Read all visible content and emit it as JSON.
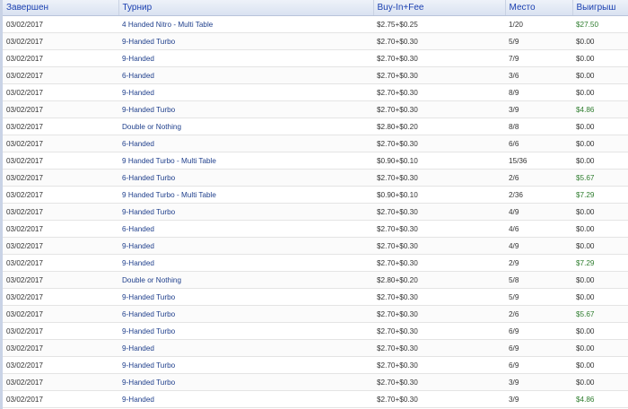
{
  "table": {
    "headers": {
      "completed": "Завершен",
      "tournament": "Турнир",
      "buyin": "Buy-In+Fee",
      "place": "Место",
      "winnings": "Выигрыш"
    },
    "rows": [
      {
        "date": "03/02/2017",
        "tournament": "4 Handed Nitro - Multi Table",
        "buyin": "$2.75+$0.25",
        "place": "1/20",
        "winnings": "$27.50",
        "won": true
      },
      {
        "date": "03/02/2017",
        "tournament": "9-Handed Turbo",
        "buyin": "$2.70+$0.30",
        "place": "5/9",
        "winnings": "$0.00",
        "won": false
      },
      {
        "date": "03/02/2017",
        "tournament": "9-Handed",
        "buyin": "$2.70+$0.30",
        "place": "7/9",
        "winnings": "$0.00",
        "won": false
      },
      {
        "date": "03/02/2017",
        "tournament": "6-Handed",
        "buyin": "$2.70+$0.30",
        "place": "3/6",
        "winnings": "$0.00",
        "won": false
      },
      {
        "date": "03/02/2017",
        "tournament": "9-Handed",
        "buyin": "$2.70+$0.30",
        "place": "8/9",
        "winnings": "$0.00",
        "won": false
      },
      {
        "date": "03/02/2017",
        "tournament": "9-Handed Turbo",
        "buyin": "$2.70+$0.30",
        "place": "3/9",
        "winnings": "$4.86",
        "won": true
      },
      {
        "date": "03/02/2017",
        "tournament": "Double or Nothing",
        "buyin": "$2.80+$0.20",
        "place": "8/8",
        "winnings": "$0.00",
        "won": false
      },
      {
        "date": "03/02/2017",
        "tournament": "6-Handed",
        "buyin": "$2.70+$0.30",
        "place": "6/6",
        "winnings": "$0.00",
        "won": false
      },
      {
        "date": "03/02/2017",
        "tournament": "9 Handed Turbo - Multi Table",
        "buyin": "$0.90+$0.10",
        "place": "15/36",
        "winnings": "$0.00",
        "won": false
      },
      {
        "date": "03/02/2017",
        "tournament": "6-Handed Turbo",
        "buyin": "$2.70+$0.30",
        "place": "2/6",
        "winnings": "$5.67",
        "won": true
      },
      {
        "date": "03/02/2017",
        "tournament": "9 Handed Turbo - Multi Table",
        "buyin": "$0.90+$0.10",
        "place": "2/36",
        "winnings": "$7.29",
        "won": true
      },
      {
        "date": "03/02/2017",
        "tournament": "9-Handed Turbo",
        "buyin": "$2.70+$0.30",
        "place": "4/9",
        "winnings": "$0.00",
        "won": false
      },
      {
        "date": "03/02/2017",
        "tournament": "6-Handed",
        "buyin": "$2.70+$0.30",
        "place": "4/6",
        "winnings": "$0.00",
        "won": false
      },
      {
        "date": "03/02/2017",
        "tournament": "9-Handed",
        "buyin": "$2.70+$0.30",
        "place": "4/9",
        "winnings": "$0.00",
        "won": false
      },
      {
        "date": "03/02/2017",
        "tournament": "9-Handed",
        "buyin": "$2.70+$0.30",
        "place": "2/9",
        "winnings": "$7.29",
        "won": true
      },
      {
        "date": "03/02/2017",
        "tournament": "Double or Nothing",
        "buyin": "$2.80+$0.20",
        "place": "5/8",
        "winnings": "$0.00",
        "won": false
      },
      {
        "date": "03/02/2017",
        "tournament": "9-Handed Turbo",
        "buyin": "$2.70+$0.30",
        "place": "5/9",
        "winnings": "$0.00",
        "won": false
      },
      {
        "date": "03/02/2017",
        "tournament": "6-Handed Turbo",
        "buyin": "$2.70+$0.30",
        "place": "2/6",
        "winnings": "$5.67",
        "won": true
      },
      {
        "date": "03/02/2017",
        "tournament": "9-Handed Turbo",
        "buyin": "$2.70+$0.30",
        "place": "6/9",
        "winnings": "$0.00",
        "won": false
      },
      {
        "date": "03/02/2017",
        "tournament": "9-Handed",
        "buyin": "$2.70+$0.30",
        "place": "6/9",
        "winnings": "$0.00",
        "won": false
      },
      {
        "date": "03/02/2017",
        "tournament": "9-Handed Turbo",
        "buyin": "$2.70+$0.30",
        "place": "6/9",
        "winnings": "$0.00",
        "won": false
      },
      {
        "date": "03/02/2017",
        "tournament": "9-Handed Turbo",
        "buyin": "$2.70+$0.30",
        "place": "3/9",
        "winnings": "$0.00",
        "won": false
      },
      {
        "date": "03/02/2017",
        "tournament": "9-Handed",
        "buyin": "$2.70+$0.30",
        "place": "3/9",
        "winnings": "$4.86",
        "won": true
      }
    ]
  },
  "colors": {
    "header_text": "#1a3fb0",
    "tournament_text": "#1f3f8c",
    "winnings_positive": "#2f7d2f",
    "cell_text": "#333333"
  }
}
